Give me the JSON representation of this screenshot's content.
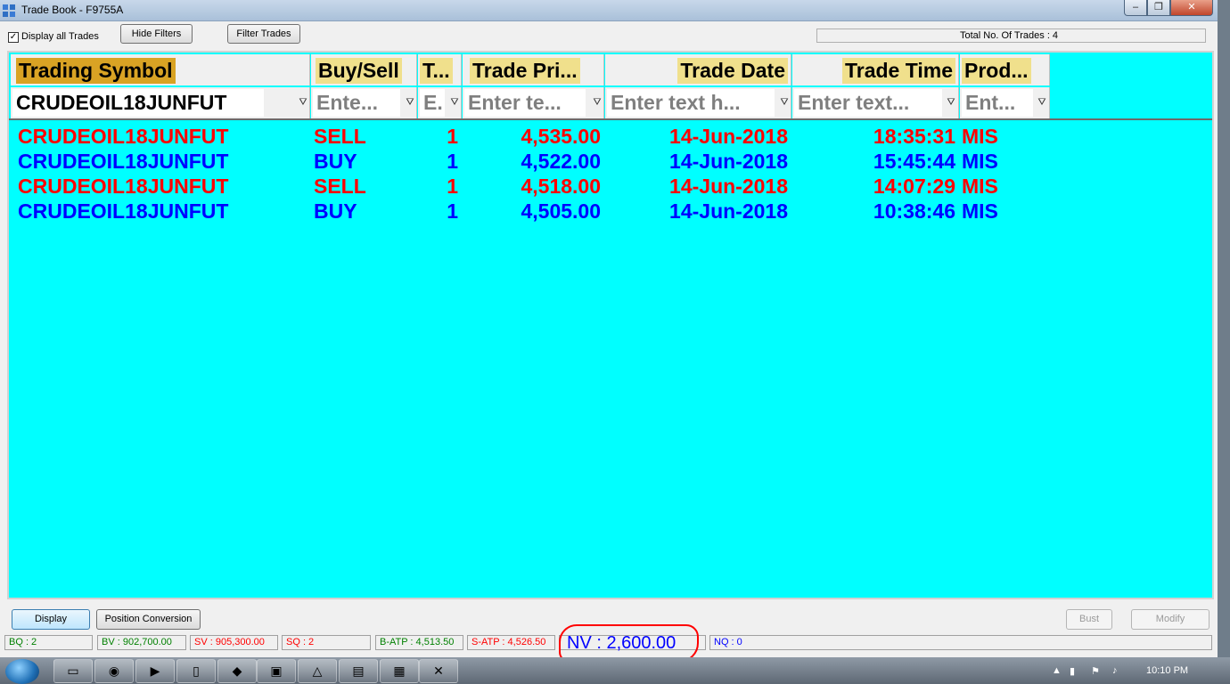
{
  "window": {
    "title": "Trade Book - F9755A",
    "min_glyph": "‒",
    "max_glyph": "❐",
    "close_glyph": "✕"
  },
  "toolbar": {
    "display_all_label": "Display all Trades",
    "display_all_checked": true,
    "hide_filters_label": "Hide Filters",
    "filter_trades_label": "Filter Trades",
    "total_trades_text": "Total No. Of Trades : 4"
  },
  "grid": {
    "columns": [
      "Trading Symbol",
      "Buy/Sell",
      "T...",
      "Trade Pri...",
      "Trade Date",
      "Trade Time",
      "Prod..."
    ],
    "filters": [
      "CRUDEOIL18JUNFUT",
      "Ente...",
      "E.",
      "Enter te...",
      "Enter text h...",
      "Enter text...",
      "Ent..."
    ],
    "rows": [
      {
        "symbol": "CRUDEOIL18JUNFUT",
        "side": "SELL",
        "qty": "1",
        "price": "4,535.00",
        "date": "14-Jun-2018",
        "time": "18:35:31",
        "product": "MIS"
      },
      {
        "symbol": "CRUDEOIL18JUNFUT",
        "side": "BUY",
        "qty": "1",
        "price": "4,522.00",
        "date": "14-Jun-2018",
        "time": "15:45:44",
        "product": "MIS"
      },
      {
        "symbol": "CRUDEOIL18JUNFUT",
        "side": "SELL",
        "qty": "1",
        "price": "4,518.00",
        "date": "14-Jun-2018",
        "time": "14:07:29",
        "product": "MIS"
      },
      {
        "symbol": "CRUDEOIL18JUNFUT",
        "side": "BUY",
        "qty": "1",
        "price": "4,505.00",
        "date": "14-Jun-2018",
        "time": "10:38:46",
        "product": "MIS"
      }
    ]
  },
  "bottom": {
    "display_label": "Display",
    "position_conversion_label": "Position Conversion",
    "bust_label": "Bust",
    "modify_label": "Modify"
  },
  "status": {
    "bq": "BQ : 2",
    "bv": "BV : 902,700.00",
    "sv": "SV : 905,300.00",
    "sq": "SQ : 2",
    "batp": "B-ATP : 4,513.50",
    "satp": "S-ATP : 4,526.50",
    "nv": "NV : 2,600.00",
    "nq": "NQ : 0"
  },
  "taskbar": {
    "clock": "10:10 PM"
  },
  "colors": {
    "sell": "#ff0000",
    "buy": "#0000ff",
    "grid_bg": "#00ffff",
    "header_highlight": "#f0e08c",
    "sorted_header": "#d9a324"
  }
}
